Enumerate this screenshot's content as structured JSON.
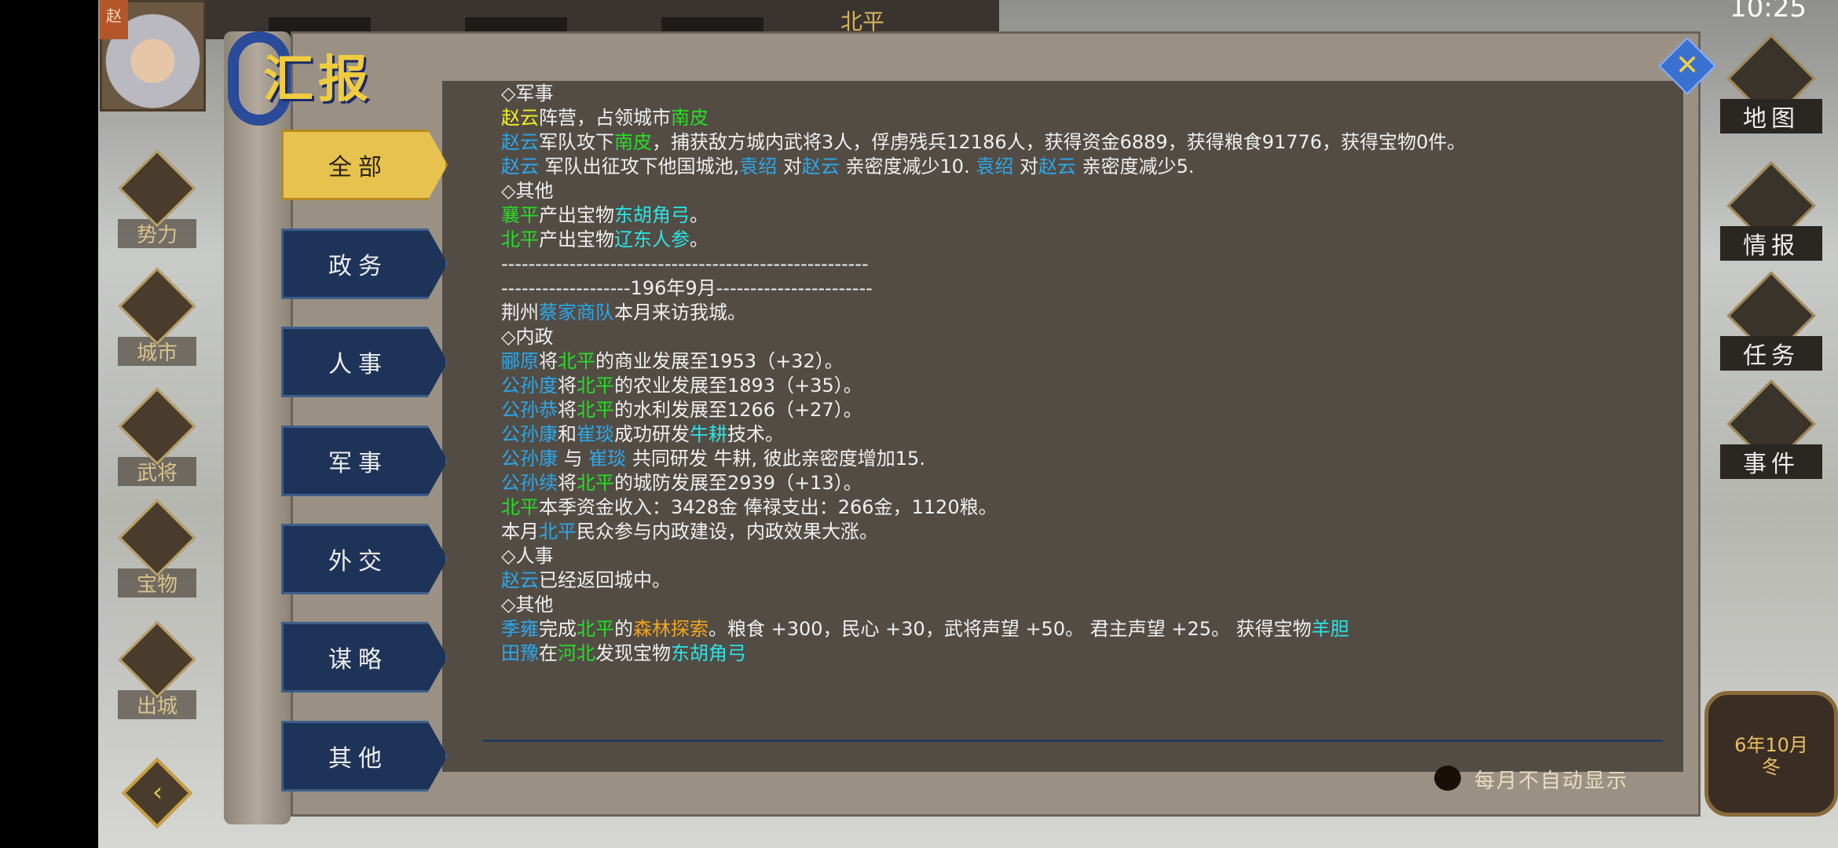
{
  "status_bar": {
    "time": "10:25"
  },
  "header": {
    "city": "北平",
    "avatar_badge": "赵"
  },
  "dialog": {
    "title": "汇报",
    "footer_checkbox_label": "每月不自动显示",
    "checkbox_checked": false
  },
  "tabs": [
    {
      "label": "全部",
      "active": true
    },
    {
      "label": "政务"
    },
    {
      "label": "人事"
    },
    {
      "label": "军事"
    },
    {
      "label": "外交"
    },
    {
      "label": "谋略"
    },
    {
      "label": "其他"
    }
  ],
  "left_menu": [
    {
      "label": "势力",
      "icon": "faction-icon"
    },
    {
      "label": "城市",
      "icon": "city-icon"
    },
    {
      "label": "武将",
      "icon": "general-icon"
    },
    {
      "label": "宝物",
      "icon": "treasure-chest-icon"
    },
    {
      "label": "出城",
      "icon": "city-gate-icon"
    }
  ],
  "right_menu": [
    {
      "label": "地图",
      "icon": "map-icon"
    },
    {
      "label": "情报",
      "icon": "intel-icon"
    },
    {
      "label": "任务",
      "icon": "scroll-icon"
    },
    {
      "label": "事件",
      "icon": "event-icon"
    }
  ],
  "date_badge": {
    "date": "6年10月",
    "season": "冬"
  },
  "colors": {
    "w": "#f0f0ee",
    "b": "#2aa8ea",
    "g": "#24e024",
    "y": "#f4f01e",
    "c": "#2ae4e4",
    "o": "#f0a61e"
  },
  "log": [
    [
      {
        "t": "◇军事",
        "c": "w"
      }
    ],
    [
      {
        "t": "赵云",
        "c": "y"
      },
      {
        "t": "阵营，占领城市",
        "c": "w"
      },
      {
        "t": "南皮",
        "c": "g"
      }
    ],
    [
      {
        "t": "赵云",
        "c": "b"
      },
      {
        "t": "军队攻下",
        "c": "w"
      },
      {
        "t": "南皮",
        "c": "g"
      },
      {
        "t": "，捕获敌方城内武将3人，俘虏残兵12186人，获得资金6889，获得粮食91776，获得宝物0件。",
        "c": "w"
      }
    ],
    [
      {
        "t": "赵云",
        "c": "b"
      },
      {
        "t": " 军队出征攻下他国城池,",
        "c": "w"
      },
      {
        "t": "袁绍",
        "c": "b"
      },
      {
        "t": " 对",
        "c": "w"
      },
      {
        "t": "赵云",
        "c": "b"
      },
      {
        "t": " 亲密度减少10. ",
        "c": "w"
      },
      {
        "t": "袁绍",
        "c": "b"
      },
      {
        "t": " 对",
        "c": "w"
      },
      {
        "t": "赵云",
        "c": "b"
      },
      {
        "t": " 亲密度减少5.",
        "c": "w"
      }
    ],
    [
      {
        "t": "◇其他",
        "c": "w"
      }
    ],
    [
      {
        "t": "襄平",
        "c": "g"
      },
      {
        "t": "产出宝物",
        "c": "w"
      },
      {
        "t": "东胡角弓",
        "c": "c"
      },
      {
        "t": "。",
        "c": "w"
      }
    ],
    [
      {
        "t": "北平",
        "c": "g"
      },
      {
        "t": "产出宝物",
        "c": "w"
      },
      {
        "t": "辽东人参",
        "c": "c"
      },
      {
        "t": "。",
        "c": "w"
      }
    ],
    [
      {
        "t": "------------------------------------------------------",
        "c": "w"
      }
    ],
    [
      {
        "t": "-------------------196年9月-----------------------",
        "c": "w"
      }
    ],
    [
      {
        "t": "荆州",
        "c": "w"
      },
      {
        "t": "蔡家商队",
        "c": "b"
      },
      {
        "t": "本月来访我城。",
        "c": "w"
      }
    ],
    [
      {
        "t": "◇内政",
        "c": "w"
      }
    ],
    [
      {
        "t": "郦原",
        "c": "b"
      },
      {
        "t": "将",
        "c": "w"
      },
      {
        "t": "北平",
        "c": "g"
      },
      {
        "t": "的商业发展至1953（+32）。",
        "c": "w"
      }
    ],
    [
      {
        "t": "公孙度",
        "c": "b"
      },
      {
        "t": "将",
        "c": "w"
      },
      {
        "t": "北平",
        "c": "g"
      },
      {
        "t": "的农业发展至1893（+35）。",
        "c": "w"
      }
    ],
    [
      {
        "t": "公孙恭",
        "c": "b"
      },
      {
        "t": "将",
        "c": "w"
      },
      {
        "t": "北平",
        "c": "g"
      },
      {
        "t": "的水利发展至1266（+27）。",
        "c": "w"
      }
    ],
    [
      {
        "t": "公孙康",
        "c": "b"
      },
      {
        "t": "和",
        "c": "w"
      },
      {
        "t": "崔琰",
        "c": "b"
      },
      {
        "t": "成功研发",
        "c": "w"
      },
      {
        "t": "牛耕",
        "c": "c"
      },
      {
        "t": "技术。",
        "c": "w"
      }
    ],
    [
      {
        "t": "公孙康",
        "c": "b"
      },
      {
        "t": " 与 ",
        "c": "w"
      },
      {
        "t": "崔琰",
        "c": "b"
      },
      {
        "t": " 共同研发 牛耕, 彼此亲密度增加15.",
        "c": "w"
      }
    ],
    [
      {
        "t": "公孙续",
        "c": "b"
      },
      {
        "t": "将",
        "c": "w"
      },
      {
        "t": "北平",
        "c": "g"
      },
      {
        "t": "的城防发展至2939（+13）。",
        "c": "w"
      }
    ],
    [
      {
        "t": "北平",
        "c": "g"
      },
      {
        "t": "本季资金收入：3428金 俸禄支出：266金，1120粮。",
        "c": "w"
      }
    ],
    [
      {
        "t": " 本月",
        "c": "w"
      },
      {
        "t": "北平",
        "c": "b"
      },
      {
        "t": "民众参与内政建设，内政效果大涨。",
        "c": "w"
      }
    ],
    [
      {
        "t": "◇人事",
        "c": "w"
      }
    ],
    [
      {
        "t": "赵云",
        "c": "b"
      },
      {
        "t": "已经返回城中。",
        "c": "w"
      }
    ],
    [
      {
        "t": "◇其他",
        "c": "w"
      }
    ],
    [
      {
        "t": "季雍",
        "c": "b"
      },
      {
        "t": "完成",
        "c": "w"
      },
      {
        "t": "北平",
        "c": "g"
      },
      {
        "t": "的",
        "c": "w"
      },
      {
        "t": "森林探索",
        "c": "o"
      },
      {
        "t": "。粮食 +300，民心 +30，武将声望 +50。 君主声望 +25。 获得宝物",
        "c": "w"
      },
      {
        "t": "羊胆",
        "c": "c"
      }
    ],
    [
      {
        "t": "田豫",
        "c": "b"
      },
      {
        "t": "在",
        "c": "w"
      },
      {
        "t": "河北",
        "c": "g"
      },
      {
        "t": "发现宝物",
        "c": "w"
      },
      {
        "t": "东胡角弓",
        "c": "c"
      }
    ]
  ]
}
